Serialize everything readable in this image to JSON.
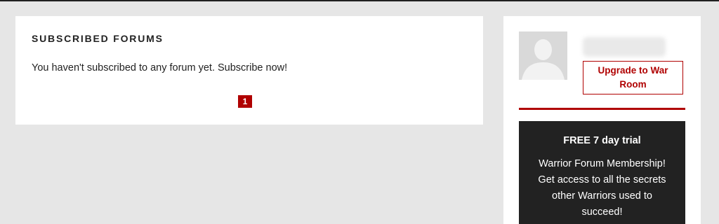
{
  "main": {
    "title": "SUBSCRIBED FORUMS",
    "empty_message": "You haven't subscribed to any forum yet. Subscribe now!",
    "pagination": {
      "current_page": "1"
    }
  },
  "sidebar": {
    "avatar_icon": "default-user-avatar",
    "username": "",
    "upgrade_label": "Upgrade to War Room",
    "promo": {
      "title": "FREE 7 day trial",
      "text": "Warrior Forum Membership! Get access to all the secrets other Warriors used to succeed!"
    }
  },
  "colors": {
    "accent": "#b00000",
    "page_background": "#e6e6e6",
    "card_background": "#ffffff",
    "promo_background": "#222222",
    "text": "#222222"
  }
}
